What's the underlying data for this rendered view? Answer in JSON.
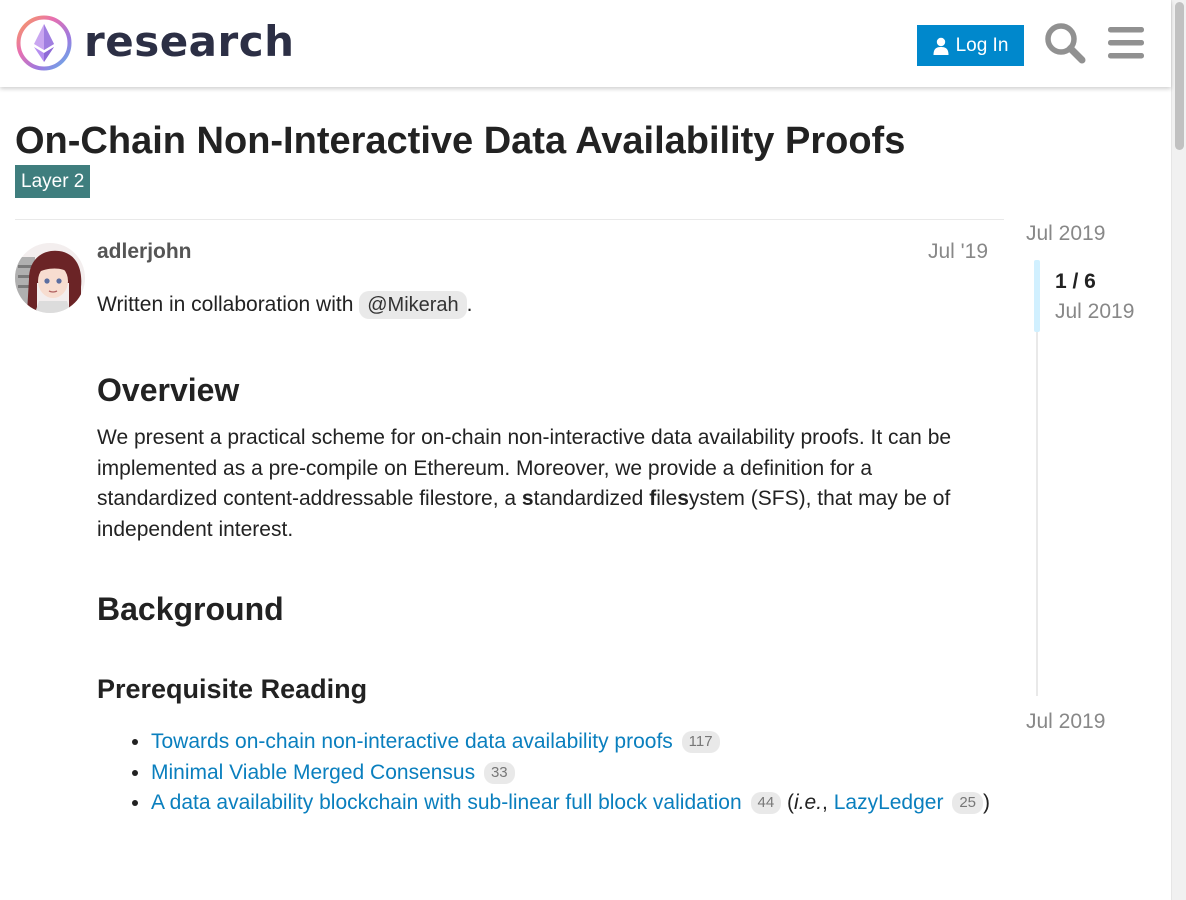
{
  "header": {
    "site_name": "research",
    "login_label": "Log In"
  },
  "topic": {
    "title": "On-Chain Non-Interactive Data Availability Proofs",
    "category": "Layer 2",
    "category_color": "#3f7e7e"
  },
  "post": {
    "author": "adlerjohn",
    "date": "Jul '19",
    "intro_prefix": "Written in collaboration with ",
    "mention": "@Mikerah",
    "intro_suffix": ".",
    "heading_overview": "Overview",
    "overview_text_1": "We present a practical scheme for on-chain non-interactive data availability proofs. It can be implemented as a pre-compile on Ethereum. Moreover, we provide a definition for a standardized content-addressable filestore, a ",
    "sfs_s1": "s",
    "sfs_mid1": "tandardized ",
    "sfs_f": "f",
    "sfs_mid2": "ile",
    "sfs_s2": "s",
    "sfs_mid3": "ystem (SFS), that may be of independent interest.",
    "heading_background": "Background",
    "heading_prereq": "Prerequisite Reading",
    "reading": [
      {
        "title": "Towards on-chain non-interactive data availability proofs",
        "clicks": "117"
      },
      {
        "title": "Minimal Viable Merged Consensus",
        "clicks": "33"
      },
      {
        "title": "A data availability blockchain with sub-linear full block validation",
        "clicks": "44"
      }
    ],
    "reading_extra": {
      "open_paren": "(",
      "ie": "i.e.",
      "comma": ", ",
      "link": "LazyLedger",
      "clicks": "25",
      "close_paren": ")"
    }
  },
  "timeline": {
    "start_date": "Jul 2019",
    "position": "1 / 6",
    "position_date": "Jul 2019",
    "end_date": "Jul 2019"
  },
  "colors": {
    "primary": "#0088cc",
    "link": "#0a7fbe",
    "text": "#222222",
    "muted": "#888888"
  },
  "icons": {
    "logo": "ethereum-research-logo-icon",
    "login": "user-icon",
    "search": "search-icon",
    "menu": "hamburger-menu-icon"
  }
}
